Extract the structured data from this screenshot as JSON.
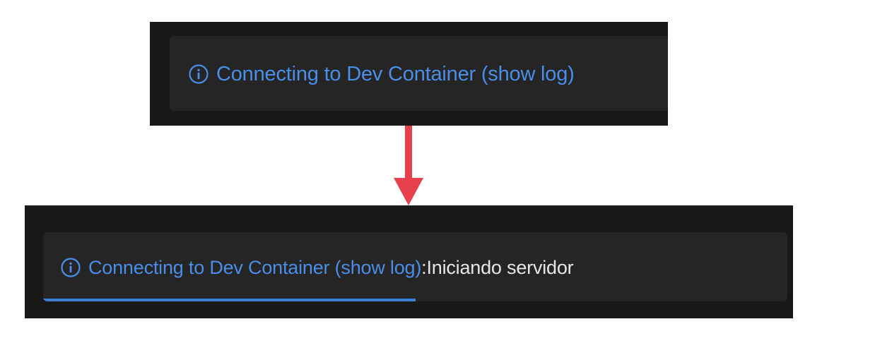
{
  "before": {
    "icon": "info-icon",
    "link_text": "Connecting to Dev Container (show log)"
  },
  "after": {
    "icon": "info-icon",
    "link_text": "Connecting to Dev Container (show log)",
    "separator": ":",
    "message": " Iniciando servidor",
    "progress_fraction": 0.5
  },
  "colors": {
    "accent": "#4a8ee8",
    "progress": "#3c7fd9",
    "arrow": "#e6404b",
    "toast_bg": "#252526",
    "panel_bg": "#181818"
  }
}
